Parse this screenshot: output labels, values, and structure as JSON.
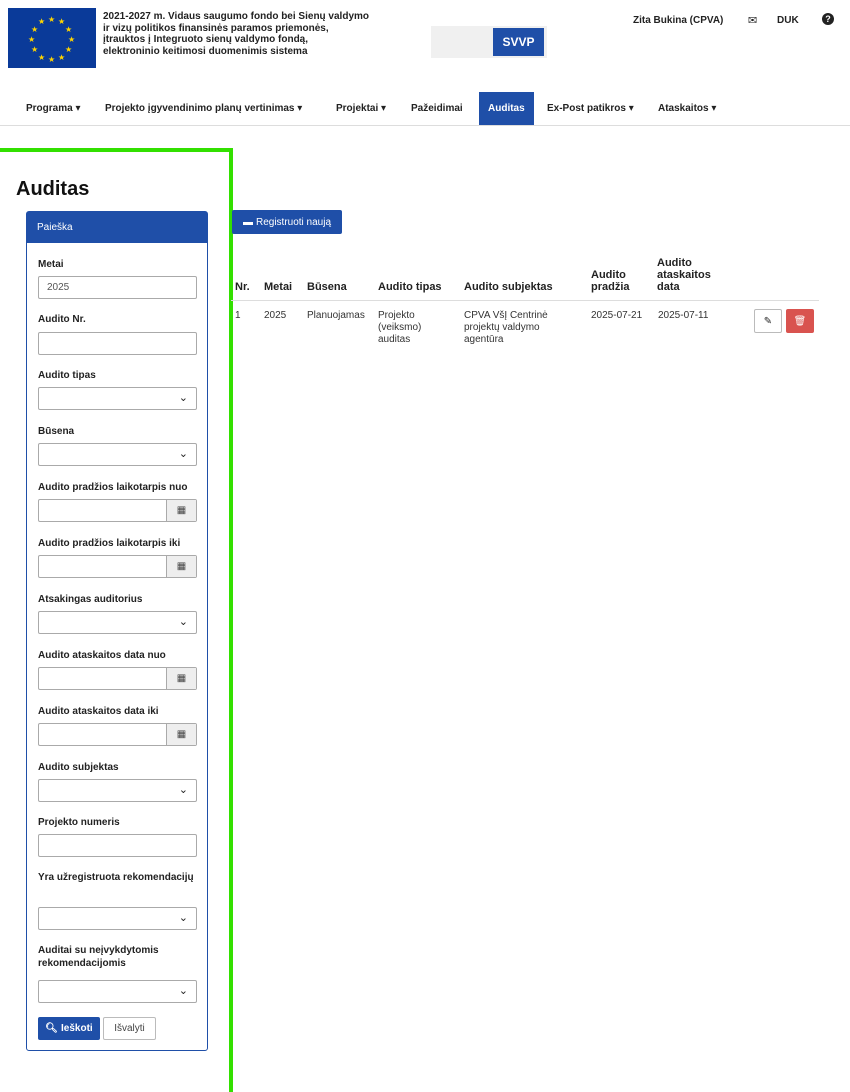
{
  "header": {
    "title_lines": [
      "2021-2027 m. Vidaus saugumo fondo bei Sienų valdymo",
      "ir vizų politikos finansinės paramos priemonės,",
      "įtrauktos į Integruoto sienų valdymo fondą,",
      "elektroninio keitimosi duomenimis sistema"
    ],
    "logo_label": "SVVP",
    "user": "Zita Bukina (CPVA)",
    "duk": "DUK"
  },
  "nav": [
    "Programa ▾",
    "Projekto įgyvendinimo planų vertinimas ▾",
    "Projektai ▾",
    "Pažeidimai",
    "Auditas",
    "Ex-Post patikros ▾",
    "Ataskaitos ▾"
  ],
  "page": {
    "title": "Auditas"
  },
  "search": {
    "panel_title": "Paieška",
    "fields": {
      "metai": {
        "label": "Metai",
        "value": "2025"
      },
      "audito_nr": {
        "label": "Audito Nr.",
        "value": ""
      },
      "audito_tipas": {
        "label": "Audito tipas"
      },
      "busena": {
        "label": "Būsena"
      },
      "pradzia_nuo": {
        "label": "Audito pradžios laikotarpis nuo"
      },
      "pradzia_iki": {
        "label": "Audito pradžios laikotarpis iki"
      },
      "auditorius": {
        "label": "Atsakingas auditorius"
      },
      "ataskaita_nuo": {
        "label": "Audito ataskaitos data nuo"
      },
      "ataskaita_iki": {
        "label": "Audito ataskaitos data iki"
      },
      "subjektas": {
        "label": "Audito subjektas"
      },
      "projekto_numeris": {
        "label": "Projekto numeris"
      },
      "rekomendaciju": {
        "label": "Yra užregistruota rekomendacijų"
      },
      "neivykdytos": {
        "label": "Auditai su neįvykdytomis rekomendacijomis"
      }
    },
    "search_button": "Ieškoti",
    "clear_button": "Išvalyti"
  },
  "actions": {
    "register": "Registruoti naują"
  },
  "table": {
    "columns": [
      "Nr.",
      "Metai",
      "Būsena",
      "Audito tipas",
      "Audito subjektas",
      "Audito pradžia",
      "Audito ataskaitos data"
    ],
    "rows": [
      [
        "1",
        "2025",
        "Planuojamas",
        "Projekto (veiksmo) auditas",
        "CPVA VšĮ Centrinė projektų valdymo agentūra",
        "2025-07-21",
        "2025-07-11"
      ]
    ]
  }
}
